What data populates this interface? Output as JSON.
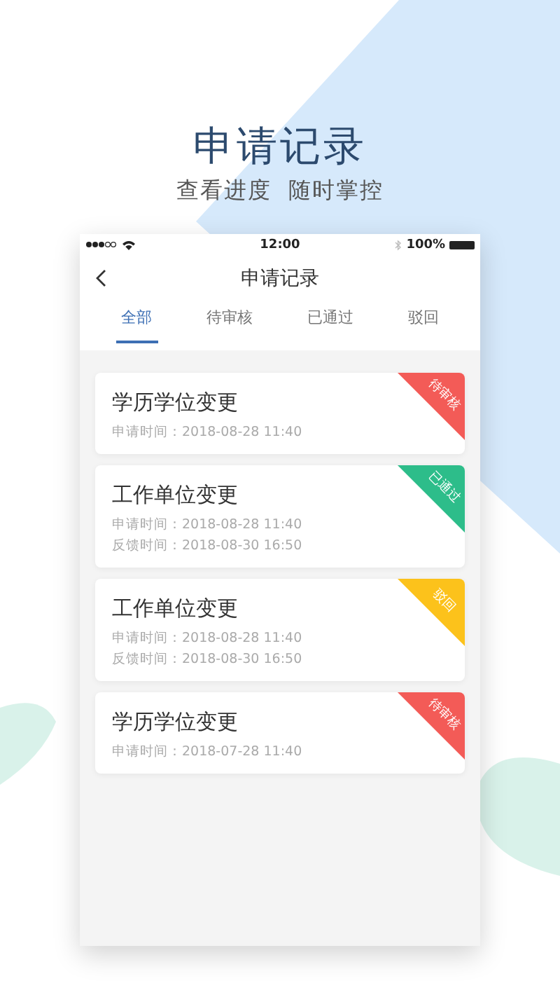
{
  "header": {
    "title": "申请记录",
    "subtitle": "查看进度  随时掌控"
  },
  "status_bar": {
    "time": "12:00",
    "battery": "100%"
  },
  "nav": {
    "title": "申请记录"
  },
  "tabs": [
    {
      "label": "全部",
      "selected": true
    },
    {
      "label": "待审核",
      "selected": false
    },
    {
      "label": "已通过",
      "selected": false
    },
    {
      "label": "驳回",
      "selected": false
    }
  ],
  "records": [
    {
      "title": "学历学位变更",
      "lines": [
        "申请时间：2018-08-28 11:40"
      ],
      "status": {
        "label": "待审核",
        "color": "#f35b57"
      }
    },
    {
      "title": "工作单位变更",
      "lines": [
        "申请时间：2018-08-28 11:40",
        "反馈时间：2018-08-30 16:50"
      ],
      "status": {
        "label": "已通过",
        "color": "#2dbd8a"
      }
    },
    {
      "title": "工作单位变更",
      "lines": [
        "申请时间：2018-08-28 11:40",
        "反馈时间：2018-08-30 16:50"
      ],
      "status": {
        "label": "驳回",
        "color": "#fcc21b"
      }
    },
    {
      "title": "学历学位变更",
      "lines": [
        "申请时间：2018-07-28 11:40"
      ],
      "status": {
        "label": "待审核",
        "color": "#f35b57"
      }
    }
  ]
}
